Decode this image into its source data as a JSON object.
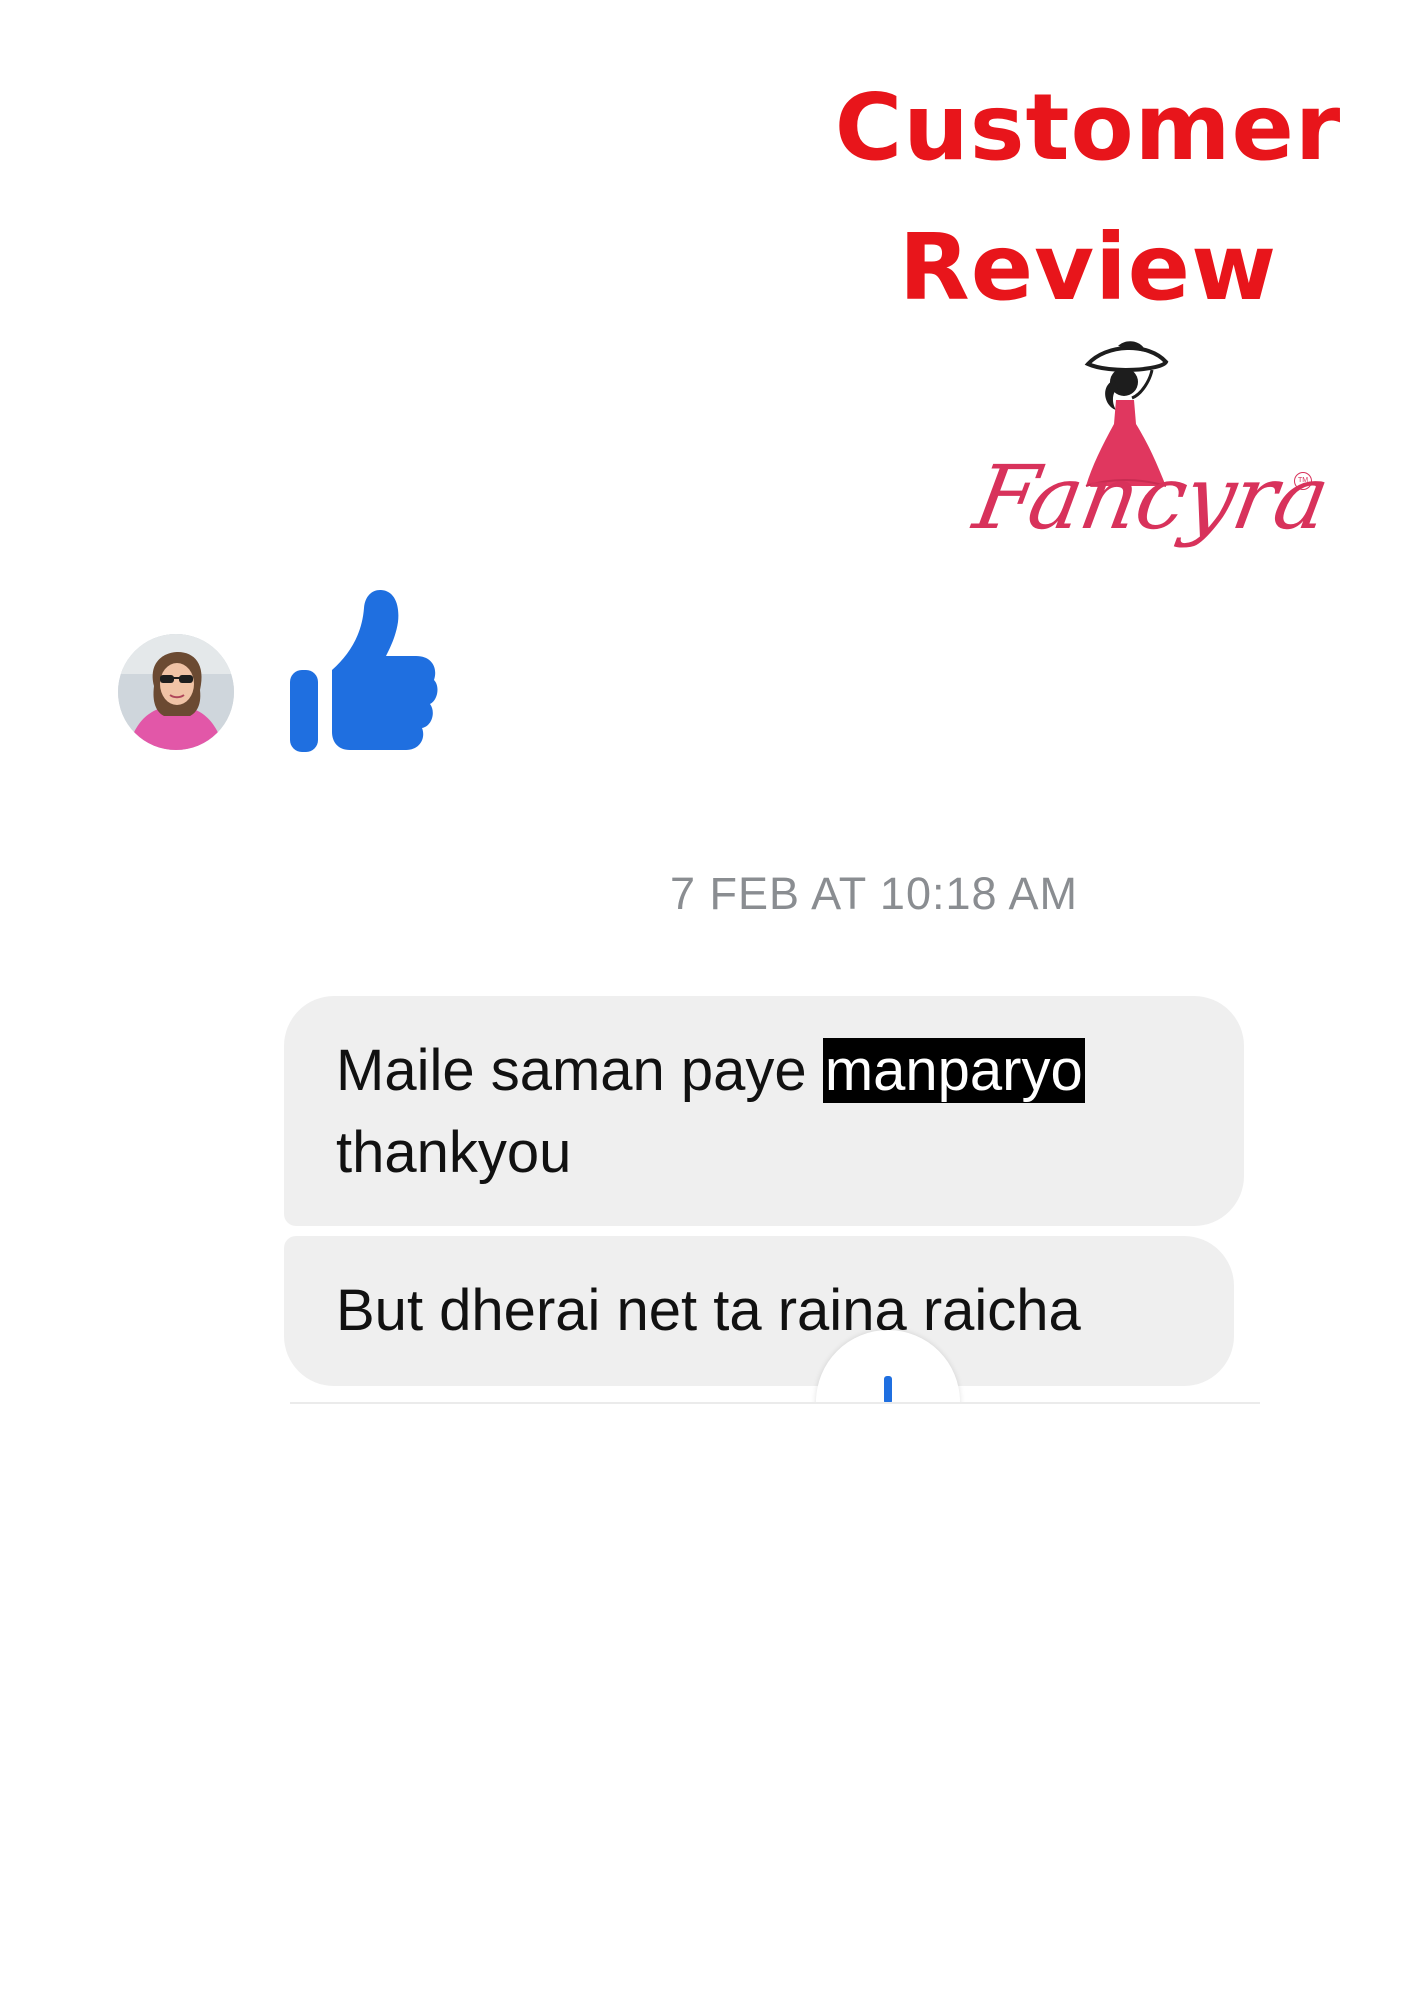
{
  "header": {
    "title_line1": "Customer",
    "title_line2": "Review",
    "color": "#e8151b"
  },
  "logo": {
    "brand": "Fancyra",
    "trademark": "TM",
    "color": "#d8325b"
  },
  "like_row": {
    "avatar_icon": "user-avatar",
    "reaction_icon": "thumbs-up-icon",
    "reaction_color": "#1f6fe0"
  },
  "chat": {
    "timestamp": "7 FEB AT 10:18 AM",
    "message1_before": "Maile saman paye ",
    "message1_highlight": "manparyo",
    "message1_line2": "thankyou",
    "message2": "But dherai net ta raina raicha",
    "scroll_icon": "arrow-down-icon"
  }
}
